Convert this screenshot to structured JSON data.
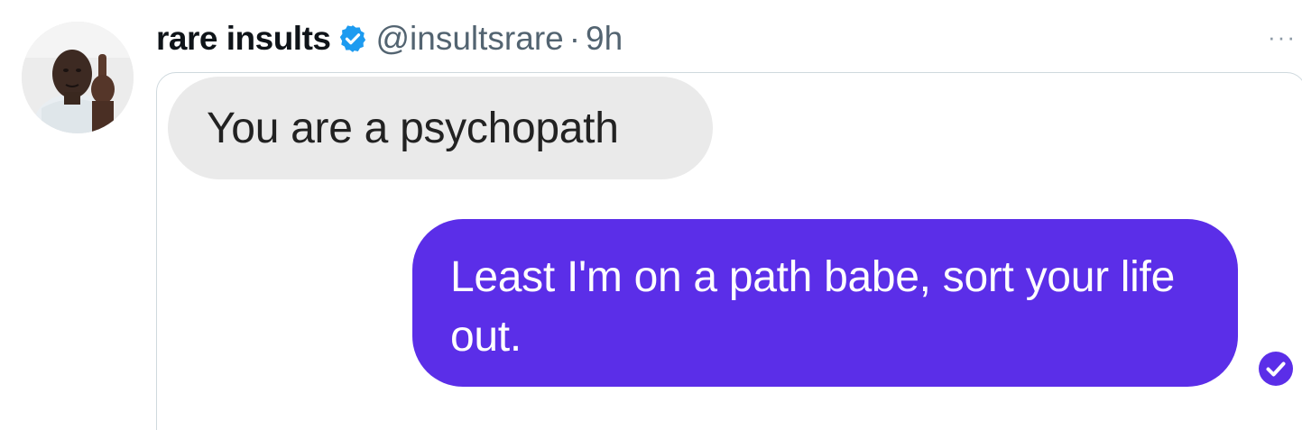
{
  "tweet": {
    "author": {
      "display_name": "rare insults",
      "handle": "@insultsrare",
      "separator": "·",
      "time": "9h",
      "verified": true,
      "avatar_icon": "avatar-photo"
    },
    "more_label": "···",
    "media": {
      "messages": [
        {
          "direction": "received",
          "text": "You are a psychopath"
        },
        {
          "direction": "sent",
          "text": "Least I'm on a path babe, sort your life out."
        }
      ],
      "read_receipt_icon": "check-circle-icon"
    }
  },
  "colors": {
    "verified_blue": "#1d9bf0",
    "sent_bubble": "#5b2ee8",
    "received_bubble": "#eaeaea",
    "secondary_text": "#536471"
  }
}
